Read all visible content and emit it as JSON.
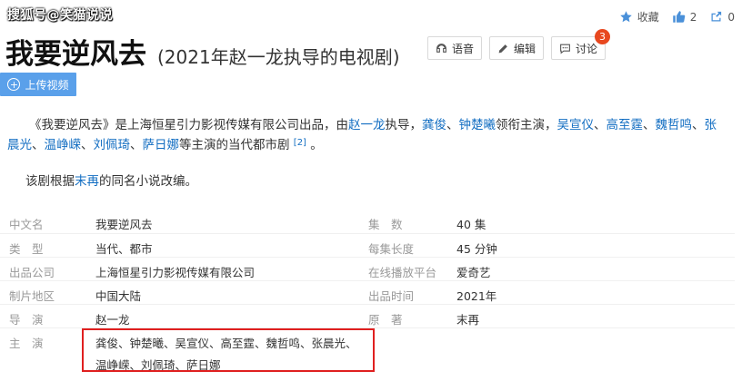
{
  "watermark": "搜狐号@笑猫说说",
  "title": {
    "main": "我要逆风去",
    "sub": "(2021年赵一龙执导的电视剧)"
  },
  "top_actions": {
    "collect_label": "收藏",
    "like_count": "2",
    "share_count": "0"
  },
  "toolbar": {
    "voice_label": "语音",
    "edit_label": "编辑",
    "discuss_label": "讨论",
    "discuss_badge": "3"
  },
  "upload_label": "上传视频",
  "intro": {
    "p1_a": "《我要逆风去》是上海恒星引力影视传媒有限公司出品，由",
    "director": "赵一龙",
    "p1_b": "执导，",
    "lead1": "龚俊",
    "sep1": "、",
    "lead2": "钟楚曦",
    "p1_c": "领衔主演，",
    "c1": "吴宣仪",
    "c2": "高至霆",
    "c3": "魏哲鸣",
    "c4": "张晨光",
    "c5": "温峥嵘",
    "c6": "刘佩琦",
    "c7": "萨日娜",
    "p1_d": "等主演的当代都市剧",
    "ref": "[2]",
    "p1_e": " 。",
    "p2_a": "该剧根据",
    "author": "末再",
    "p2_b": "的同名小说改编。"
  },
  "info": {
    "rows": [
      {
        "k1": "中文名",
        "v1": "我要逆风去",
        "k2": "集　数",
        "v2": "40 集"
      },
      {
        "k1": "类　型",
        "v1": "当代、都市",
        "k2": "每集长度",
        "v2": "45 分钟"
      },
      {
        "k1": "出品公司",
        "v1": "上海恒星引力影视传媒有限公司",
        "k2": "在线播放平台",
        "v2": "爱奇艺"
      },
      {
        "k1": "制片地区",
        "v1": "中国大陆",
        "k2": "出品时间",
        "v2": "2021年"
      },
      {
        "k1": "导　演",
        "v1": "赵一龙",
        "k2": "原　著",
        "v2": "末再"
      }
    ],
    "cast_label": "主　演",
    "cast_line1": "龚俊、钟楚曦、吴宣仪、高至霆、魏哲鸣、张晨光、",
    "cast_line2": "温峥嵘、刘佩琦、萨日娜"
  }
}
